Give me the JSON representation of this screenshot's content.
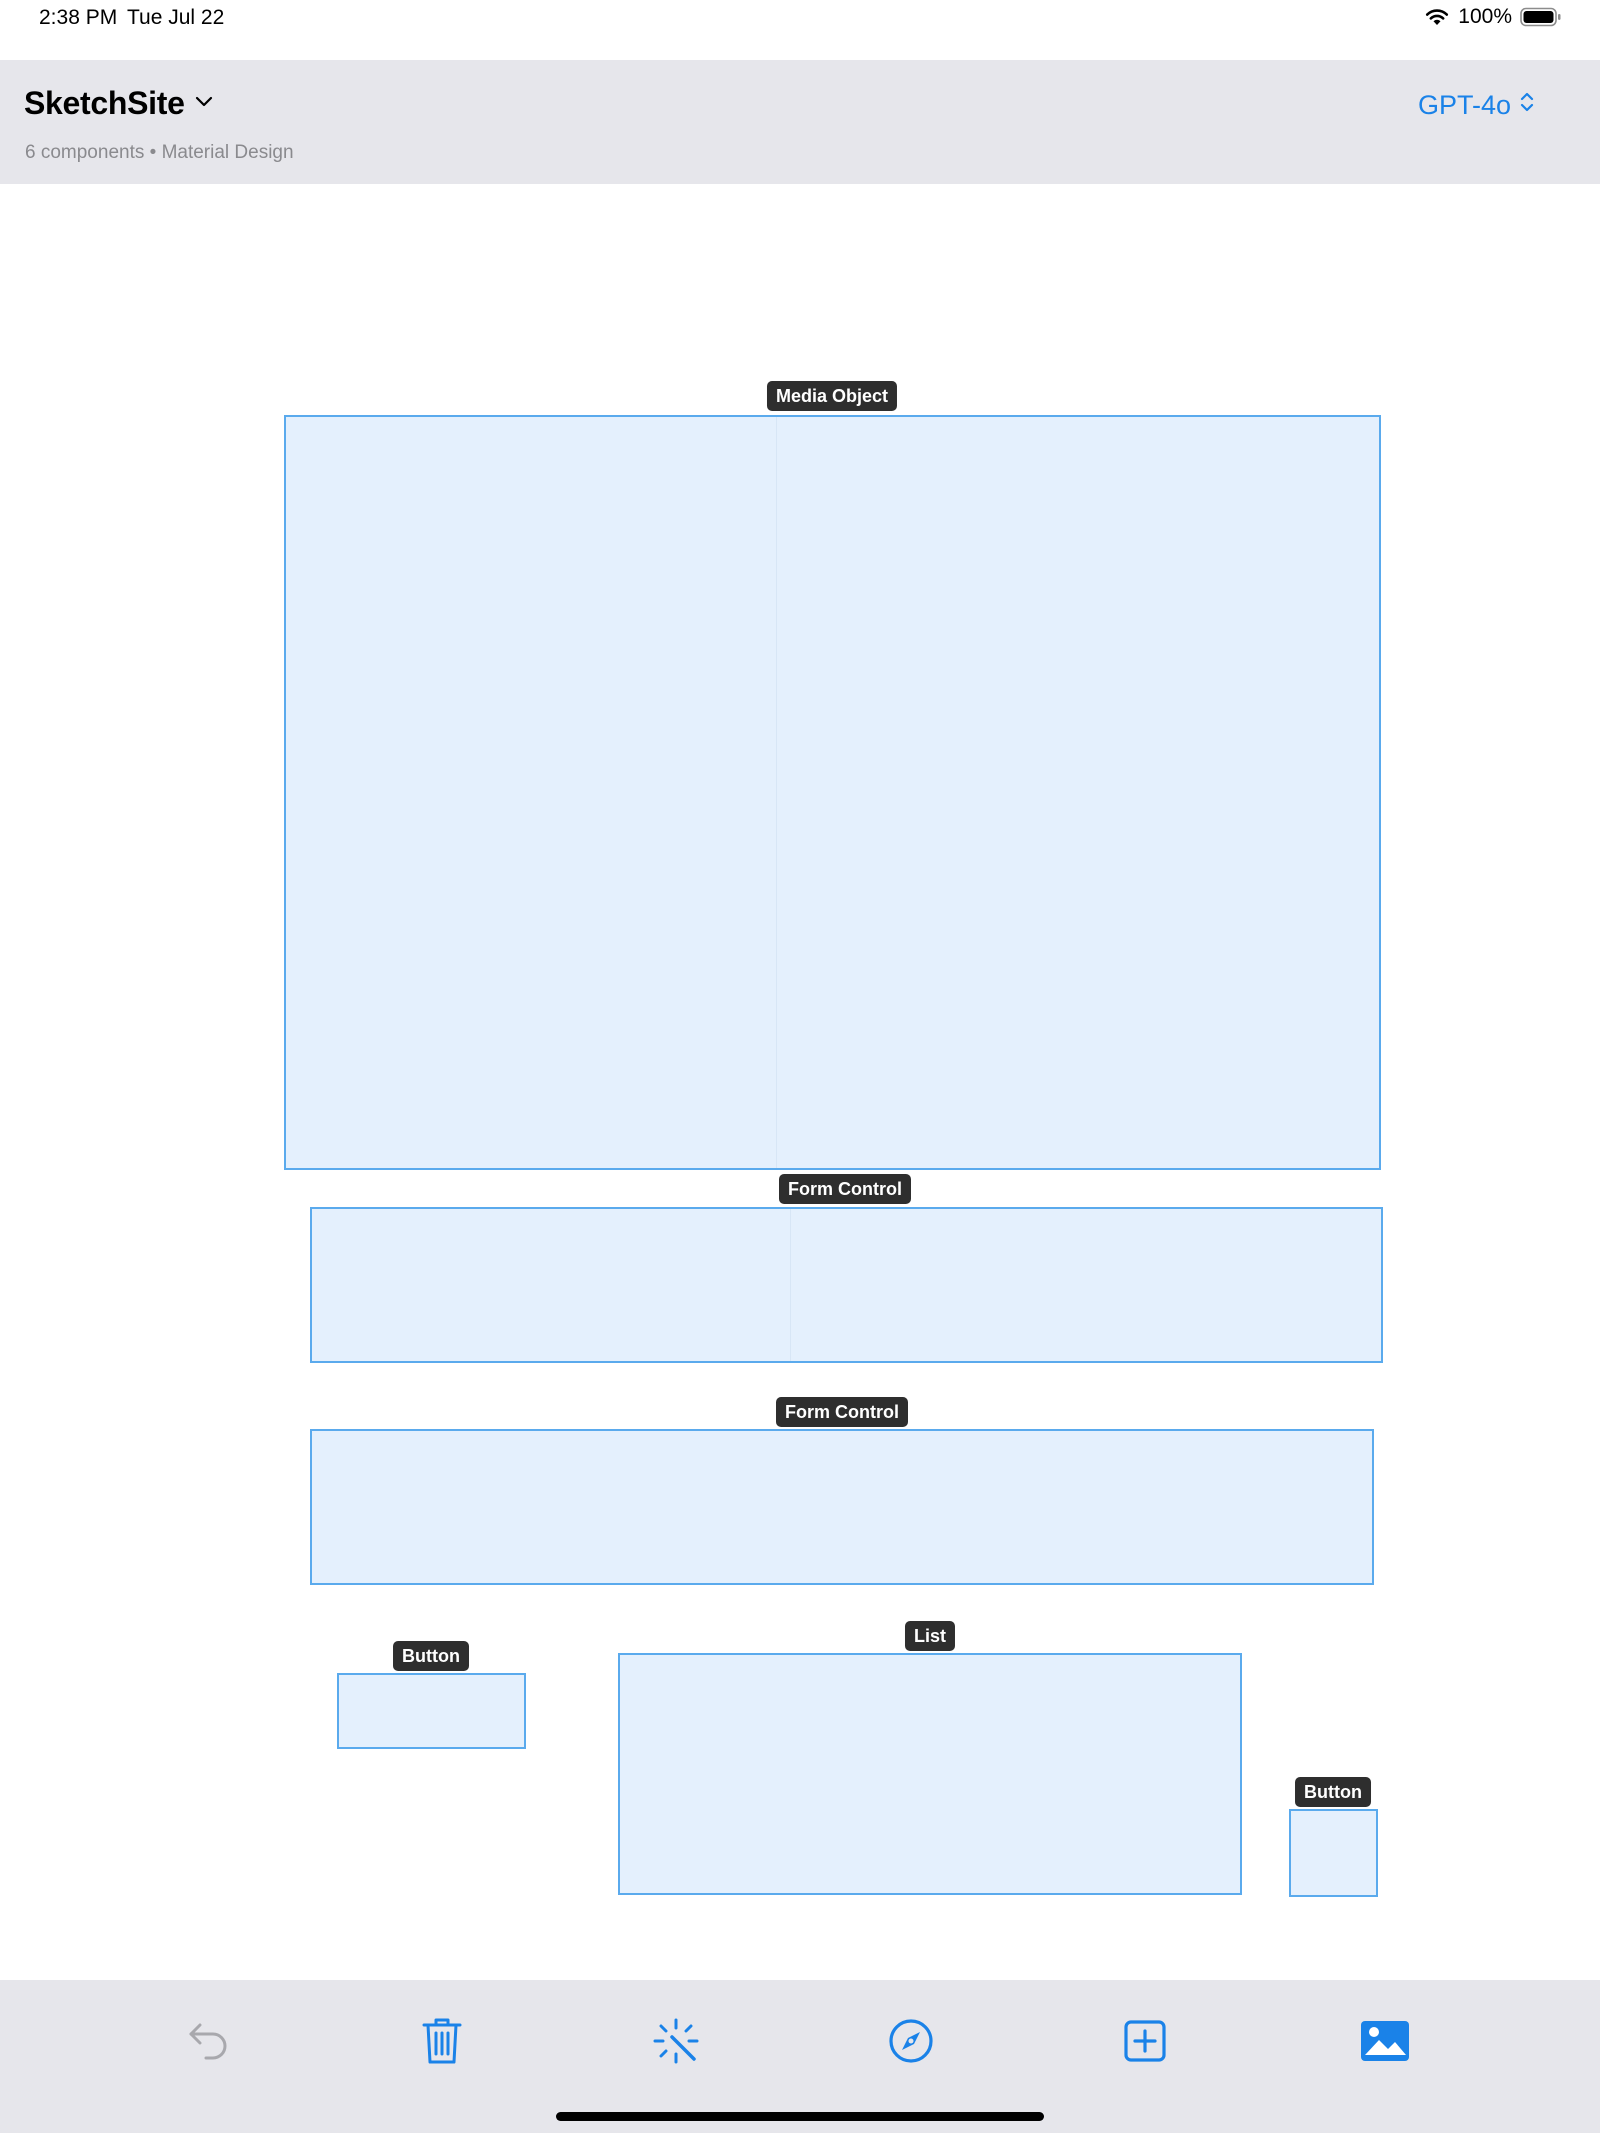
{
  "status_bar": {
    "time": "2:38 PM",
    "date": "Tue Jul 22",
    "battery": "100%"
  },
  "header": {
    "title": "SketchSite",
    "subtitle": "6 components • Material Design",
    "model": "GPT-4o"
  },
  "components": [
    {
      "label": "Media Object"
    },
    {
      "label": "Form Control"
    },
    {
      "label": "Form Control"
    },
    {
      "label": "Button"
    },
    {
      "label": "List"
    },
    {
      "label": "Button"
    }
  ],
  "toolbar": {
    "items": [
      "undo-icon",
      "trash-icon",
      "magic-wand-icon",
      "compass-icon",
      "add-square-icon",
      "photo-icon"
    ]
  },
  "colors": {
    "accent": "#1a82e8",
    "component_fill": "#e4f0fd",
    "component_border": "#5aaaed",
    "tag_bg": "#2e2e2e",
    "bar_bg": "#e6e6eb"
  }
}
